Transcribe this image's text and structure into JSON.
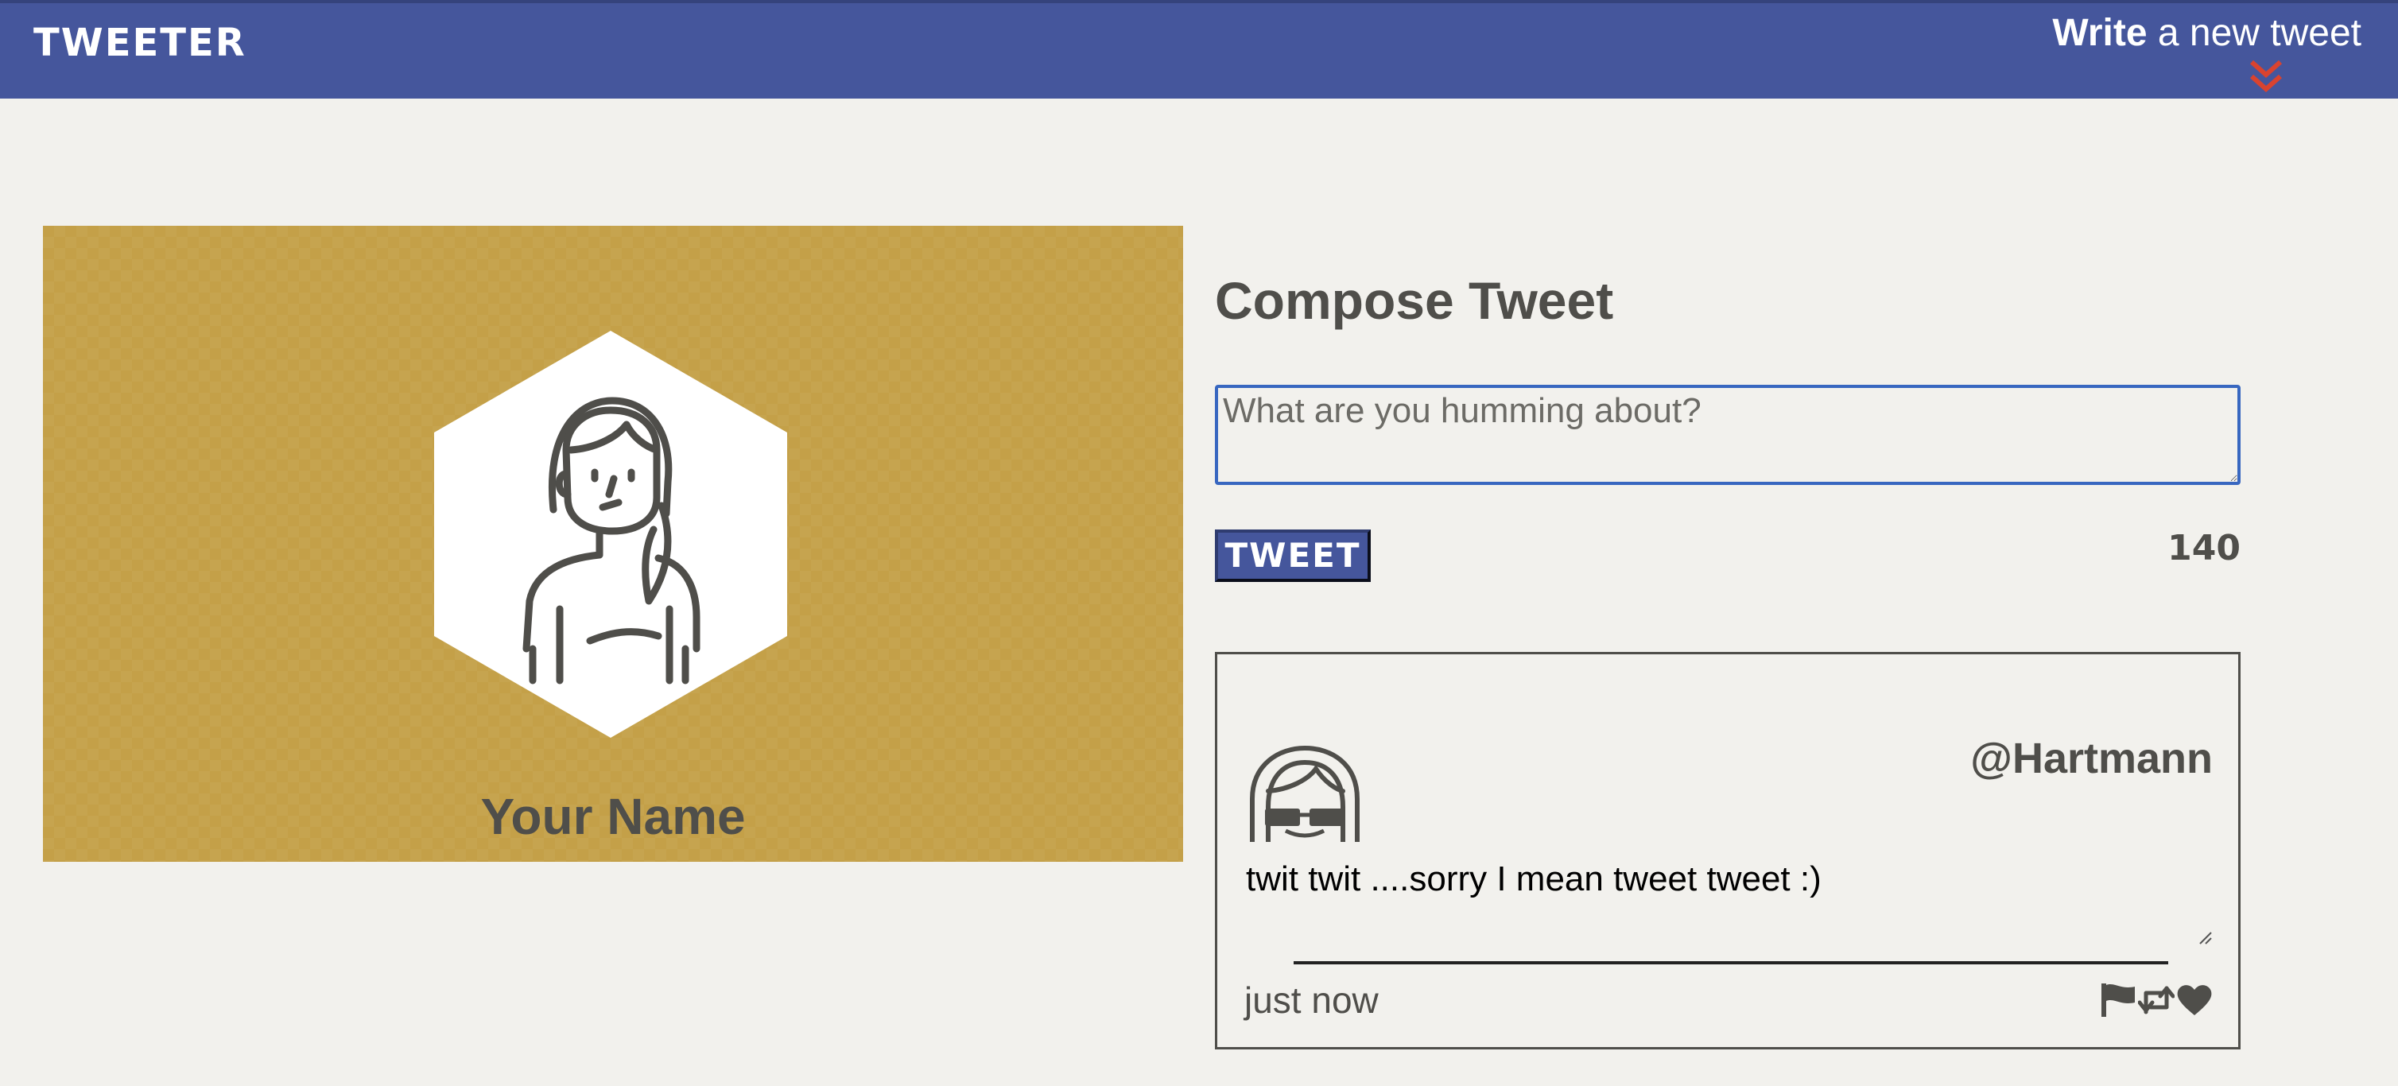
{
  "header": {
    "logo": "TWEETER",
    "write_bold": "Write",
    "write_rest": " a new tweet",
    "accent_color": "#45569c",
    "chevron_color": "#d9432f"
  },
  "profile": {
    "name": "Your Name",
    "background_color": "#c4a048"
  },
  "compose": {
    "title": "Compose Tweet",
    "placeholder": "What are you humming about?",
    "value": "",
    "button_label": "TWEET",
    "char_count": "140"
  },
  "tweet": {
    "handle": "@Hartmann",
    "text": "twit twit ....sorry I mean tweet tweet :)",
    "time": "just now",
    "actions": [
      "flag-icon",
      "retweet-icon",
      "heart-icon"
    ]
  }
}
